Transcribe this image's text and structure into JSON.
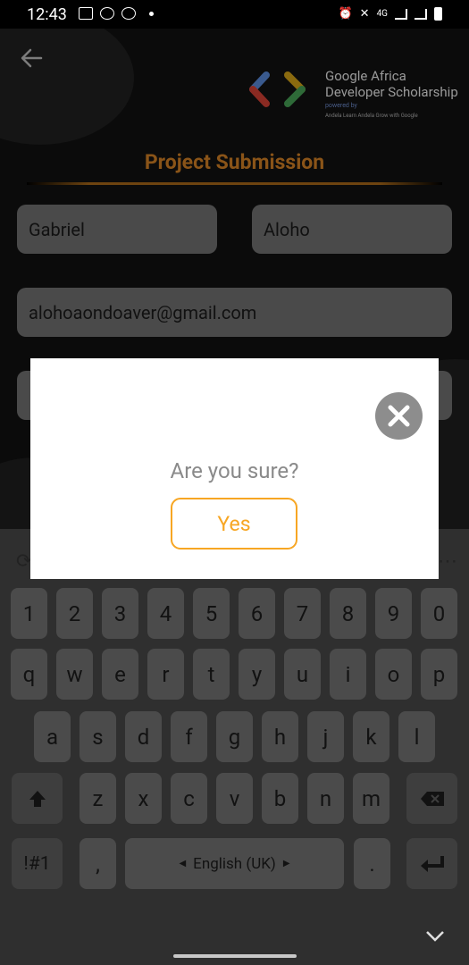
{
  "status_bar": {
    "time": "12:43",
    "network": "4G"
  },
  "app": {
    "logo": {
      "line1": "Google Africa",
      "line2": "Developer Scholarship",
      "powered_by": "powered by",
      "partners": "Andela Learn   Andela   Grow with Google"
    },
    "title": "Project Submission",
    "first_name": "Gabriel",
    "last_name": "Aloho",
    "email": "alohoaondoaver@gmail.com",
    "accent_color": "#f7a623"
  },
  "dialog": {
    "prompt": "Are you sure?",
    "yes_label": "Yes"
  },
  "keyboard": {
    "row_numbers": [
      "1",
      "2",
      "3",
      "4",
      "5",
      "6",
      "7",
      "8",
      "9",
      "0"
    ],
    "row1": [
      "q",
      "w",
      "e",
      "r",
      "t",
      "y",
      "u",
      "i",
      "o",
      "p"
    ],
    "row2": [
      "a",
      "s",
      "d",
      "f",
      "g",
      "h",
      "j",
      "k",
      "l"
    ],
    "row3": [
      "z",
      "x",
      "c",
      "v",
      "b",
      "n",
      "m"
    ],
    "symbols_label": "!#1",
    "comma": ",",
    "space_label": "English (UK)",
    "period": "."
  }
}
